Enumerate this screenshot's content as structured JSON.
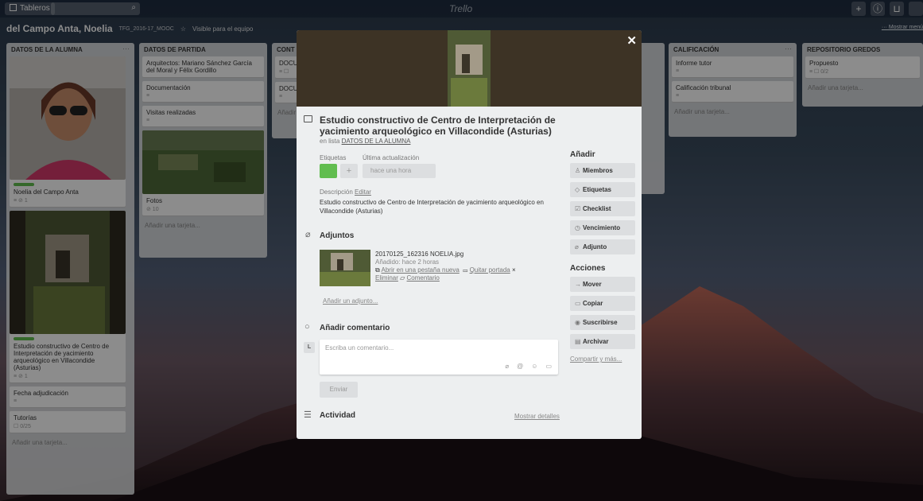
{
  "topbar": {
    "boards": "Tableros",
    "search_icon": "search-icon",
    "logo": "Trello",
    "right_icons": [
      "+",
      "ⓘ",
      "🔔"
    ]
  },
  "board": {
    "title": "del Campo Anta, Noelia",
    "org": "TFG_2016-17_MOOC",
    "visibility": "Visible para el equipo",
    "menu": "··· Mostrar menú"
  },
  "lists": [
    {
      "title": "DATOS DE LA ALUMNA",
      "cards": [
        {
          "text": "Noelia del Campo Anta",
          "meta": "≡  ⊘ 1"
        },
        {
          "text": "Estudio constructivo de Centro de Interpretación de yacimiento arqueológico en Villacondide (Asturias)",
          "meta": "≡  ⊘ 1"
        },
        {
          "text": "Fecha adjudicación",
          "meta": "≡"
        },
        {
          "text": "Tutorías",
          "meta": "☐ 0/25"
        }
      ],
      "add": "Añadir una tarjeta..."
    },
    {
      "title": "DATOS DE PARTIDA",
      "cards": [
        {
          "text": "Arquitectos: Mariano Sánchez García del Moral y Félix Gordillo",
          "meta": ""
        },
        {
          "text": "Documentación",
          "meta": "≡"
        },
        {
          "text": "Visitas realizadas",
          "meta": "≡"
        },
        {
          "text": "Fotos",
          "meta": "⊘ 10"
        }
      ],
      "add": "Añadir una tarjeta..."
    },
    {
      "title": "CONT",
      "cards": [
        {
          "text": "DOCU",
          "meta": "≡ ☐"
        },
        {
          "text": "DOCU",
          "meta": "≡"
        }
      ],
      "add": "Añadir"
    },
    {
      "title": "CALIFICACIÓN",
      "cards": [
        {
          "text": "Informe tutor",
          "meta": "≡"
        },
        {
          "text": "Calificación tribunal",
          "meta": "≡"
        }
      ],
      "add": "Añadir una tarjeta..."
    },
    {
      "title": "REPOSITORIO GREDOS",
      "cards": [
        {
          "text": "Propuesto",
          "meta": "≡  ☐ 0/2"
        }
      ],
      "add": "Añadir una tarjeta..."
    }
  ],
  "modal": {
    "title": "Estudio constructivo de Centro de Interpretación de yacimiento arqueológico en Villacondide (Asturias)",
    "in_list_prefix": "en lista",
    "in_list": "DATOS DE LA ALUMNA",
    "labels_label": "Etiquetas",
    "updated_label": "Última actualización",
    "updated_value": "hace una hora",
    "label_color": "#61bd4f",
    "description_label": "Descripción",
    "edit": "Editar",
    "description": "Estudio constructivo de Centro de Interpretación de yacimiento arqueológico en Villacondide (Asturias)",
    "attachments_title": "Adjuntos",
    "attachment": {
      "name": "20170125_162316 NOELIA.jpg",
      "added": "Añadido: hace 2 horas",
      "open_new_tab": "Abrir en una pestaña nueva",
      "remove_cover": "Quitar portada",
      "delete": "Eliminar",
      "comment": "Comentario"
    },
    "add_attachment": "Añadir un adjunto...",
    "add_comment_title": "Añadir comentario",
    "avatar_initial": "L",
    "comment_placeholder": "Escriba un comentario...",
    "send": "Enviar",
    "activity_title": "Actividad",
    "show_details": "Mostrar detalles",
    "sidebar": {
      "add_title": "Añadir",
      "add_buttons": [
        {
          "label": "Miembros",
          "icon": "user-icon"
        },
        {
          "label": "Etiquetas",
          "icon": "tag-icon"
        },
        {
          "label": "Checklist",
          "icon": "checklist-icon"
        },
        {
          "label": "Vencimiento",
          "icon": "clock-icon"
        },
        {
          "label": "Adjunto",
          "icon": "paperclip-icon"
        }
      ],
      "actions_title": "Acciones",
      "action_buttons": [
        {
          "label": "Mover",
          "icon": "arrow-right-icon"
        },
        {
          "label": "Copiar",
          "icon": "copy-icon"
        },
        {
          "label": "Suscribirse",
          "icon": "eye-icon"
        },
        {
          "label": "Archivar",
          "icon": "archive-icon"
        }
      ],
      "share": "Compartir y más..."
    }
  }
}
